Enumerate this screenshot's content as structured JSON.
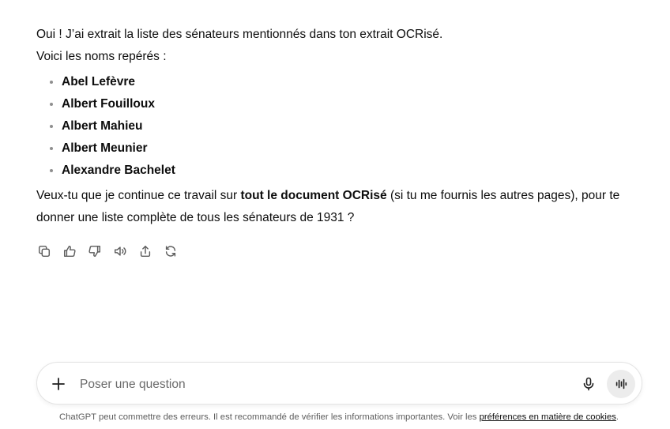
{
  "message": {
    "intro_line1": "Oui ! J’ai extrait la liste des sénateurs mentionnés dans ton extrait OCRisé.",
    "intro_line2": "Voici les noms repérés :",
    "names": [
      "Abel Lefèvre",
      "Albert Fouilloux",
      "Albert Mahieu",
      "Albert Meunier",
      "Alexandre Bachelet"
    ],
    "followup_before": "Veux-tu que je continue ce travail sur ",
    "followup_bold": "tout le document OCRisé",
    "followup_after": " (si tu me fournis les autres pages), pour te donner une liste complète de tous les sénateurs de 1931 ?"
  },
  "actions": [
    {
      "icon": "copy-icon"
    },
    {
      "icon": "thumbs-up-icon"
    },
    {
      "icon": "thumbs-down-icon"
    },
    {
      "icon": "read-aloud-icon"
    },
    {
      "icon": "share-icon"
    },
    {
      "icon": "regenerate-icon"
    }
  ],
  "composer": {
    "placeholder": "Poser une question",
    "value": ""
  },
  "footer": {
    "text": "ChatGPT peut commettre des erreurs. Il est recommandé de vérifier les informations importantes. Voir les ",
    "link": "préférences en matière de cookies",
    "end": "."
  }
}
